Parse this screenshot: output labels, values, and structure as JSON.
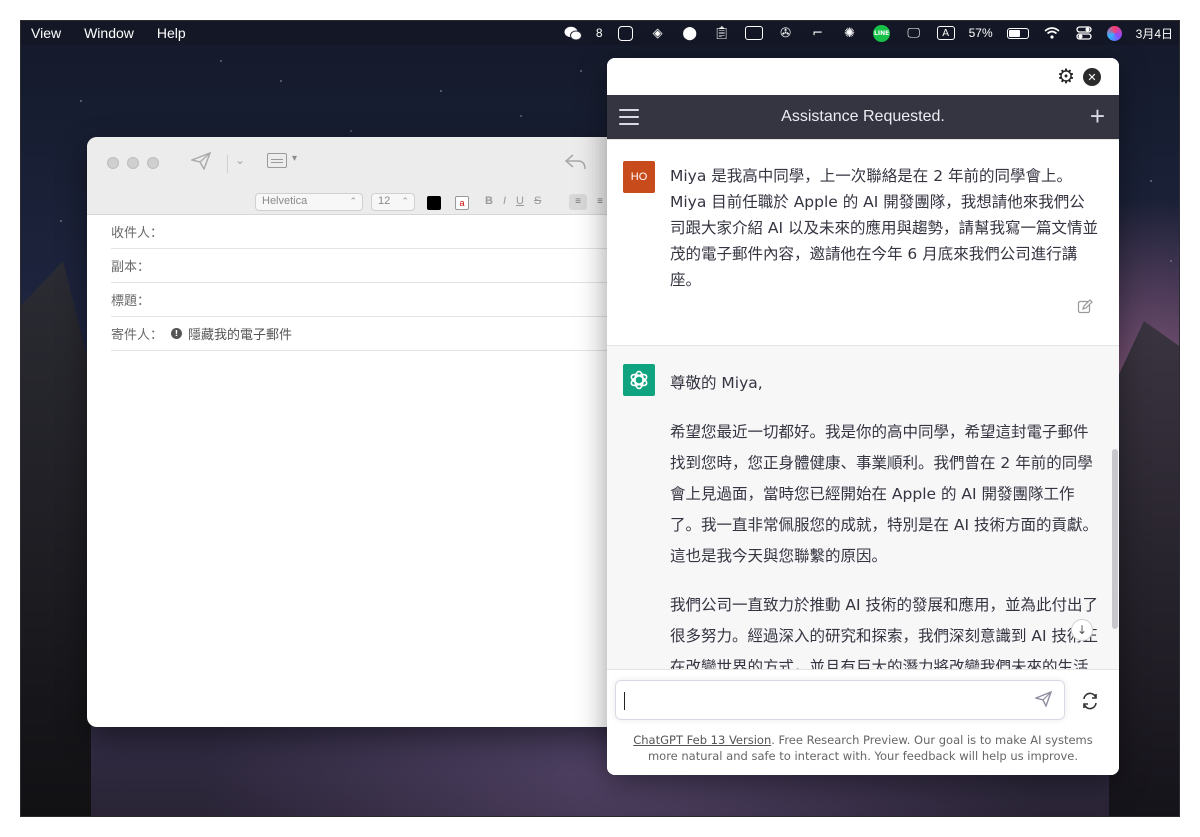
{
  "menubar": {
    "items": [
      "View",
      "Window",
      "Help"
    ],
    "wechat_count": "8",
    "battery": "57%",
    "date": "3月4日"
  },
  "mail": {
    "font": "Helvetica",
    "size": "12",
    "fields": {
      "to": "收件人：",
      "cc": "副本：",
      "subject": "標題：",
      "from": "寄件人：",
      "from_value": "隱藏我的電子郵件"
    }
  },
  "chat": {
    "title": "Assistance Requested.",
    "user_initials": "HO",
    "user_message": "Miya 是我高中同學，上一次聯絡是在 2 年前的同學會上。Miya 目前任職於 Apple 的 AI 開發團隊，我想請他來我們公司跟大家介紹 AI 以及未來的應用與趨勢，請幫我寫一篇文情並茂的電子郵件內容，邀請他在今年 6 月底來我們公司進行講座。",
    "bot_greeting": "尊敬的 Miya,",
    "bot_paragraph_1": "希望您最近一切都好。我是你的高中同學，希望這封電子郵件找到您時，您正身體健康、事業順利。我們曾在 2 年前的同學會上見過面，當時您已經開始在 Apple 的 AI 開發團隊工作了。我一直非常佩服您的成就，特別是在 AI 技術方面的貢獻。這也是我今天與您聯繫的原因。",
    "bot_paragraph_2": "我們公司一直致力於推動 AI 技術的發展和應用，並為此付出了很多努力。經過深入的研究和探索，我們深刻意識到 AI 技術正在改變世界的方式，並且有巨大的潛力將改變我們未來的生活和工作方式。因此，我們希望邀請您來",
    "input_placeholder": "",
    "footer_link": "ChatGPT Feb 13 Version",
    "footer_text": ". Free Research Preview. Our goal is to make AI systems more natural and safe to interact with. Your feedback will help us improve."
  }
}
